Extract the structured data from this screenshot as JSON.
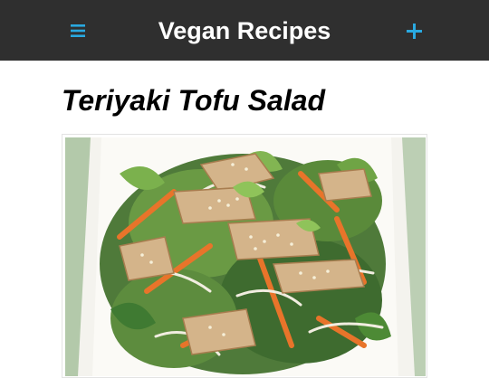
{
  "app_bar": {
    "title": "Vegan Recipes",
    "menu_icon": "hamburger-menu-icon",
    "add_icon": "plus-icon",
    "background_color": "#2f2f2f",
    "accent_color": "#29a9e0"
  },
  "recipe": {
    "title": "Teriyaki Tofu Salad",
    "photo": "salad-photo"
  }
}
